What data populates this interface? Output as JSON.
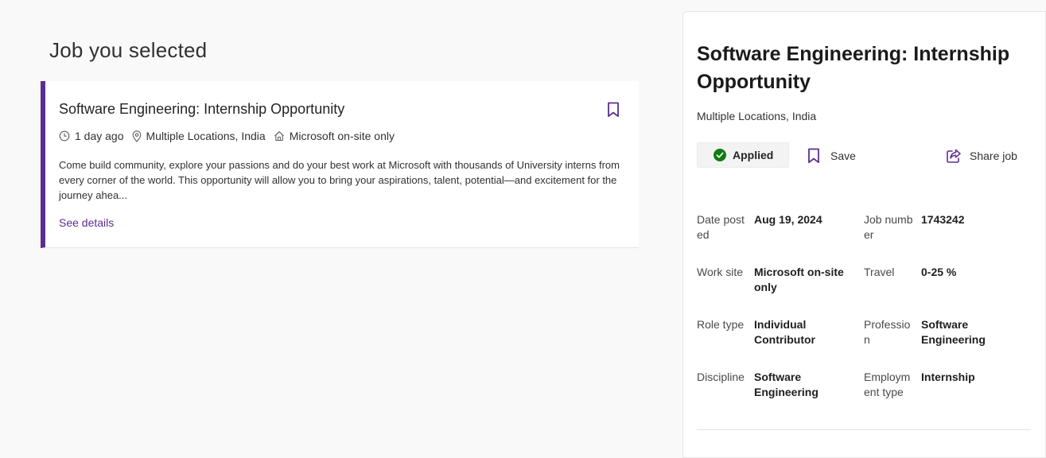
{
  "section_title": "Job you selected",
  "job_card": {
    "title": "Software Engineering: Internship Opportunity",
    "posted": "1 day ago",
    "location": "Multiple Locations, India",
    "work_site": "Microsoft on-site only",
    "description": "Come build community, explore your passions and do your best work at Microsoft with thousands of University interns from every corner of the world. This opportunity will allow you to bring your aspirations, talent, potential—and excitement for the journey ahea...",
    "see_details": "See details"
  },
  "detail": {
    "title": "Software Engineering: Internship Opportunity",
    "location": "Multiple Locations, India",
    "applied_label": "Applied",
    "save_label": "Save",
    "share_label": "Share job",
    "fields": [
      {
        "label": "Date posted",
        "value": "Aug 19, 2024"
      },
      {
        "label": "Job number",
        "value": "1743242"
      },
      {
        "label": "Work site",
        "value": "Microsoft on-site only"
      },
      {
        "label": "Travel",
        "value": "0-25 %"
      },
      {
        "label": "Role type",
        "value": "Individual Contributor"
      },
      {
        "label": "Profession",
        "value": "Software Engineering"
      },
      {
        "label": "Discipline",
        "value": "Software Engineering"
      },
      {
        "label": "Employment type",
        "value": "Internship"
      }
    ]
  },
  "colors": {
    "accent": "#5c2d91",
    "applied_green": "#107c10",
    "background": "#f9f9f9"
  },
  "icons": {
    "bookmark": "bookmark-icon",
    "clock": "clock-icon",
    "location": "location-pin-icon",
    "home": "home-icon",
    "check": "check-circle-icon",
    "share": "share-icon"
  }
}
